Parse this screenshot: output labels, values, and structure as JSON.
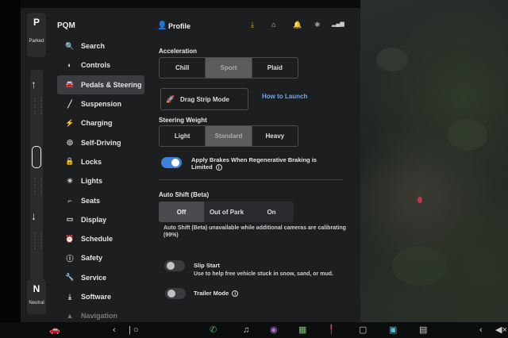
{
  "gear": {
    "top_letter": "P",
    "top_state": "Parked",
    "bottom_letter": "N",
    "bottom_state": "Neutral"
  },
  "menu": {
    "header": "PQM",
    "items": [
      {
        "label": "Search",
        "icon": "search-icon",
        "glyph": "🔍"
      },
      {
        "label": "Controls",
        "icon": "toggle-icon",
        "glyph": "◐"
      },
      {
        "label": "Pedals & Steering",
        "icon": "car-icon",
        "glyph": "🚘"
      },
      {
        "label": "Suspension",
        "icon": "suspension-icon",
        "glyph": "╱"
      },
      {
        "label": "Charging",
        "icon": "bolt-icon",
        "glyph": "⚡"
      },
      {
        "label": "Self-Driving",
        "icon": "steering-wheel-icon",
        "glyph": "◎"
      },
      {
        "label": "Locks",
        "icon": "lock-icon",
        "glyph": "🔒"
      },
      {
        "label": "Lights",
        "icon": "sun-icon",
        "glyph": "☀"
      },
      {
        "label": "Seats",
        "icon": "seat-icon",
        "glyph": "⌐"
      },
      {
        "label": "Display",
        "icon": "display-icon",
        "glyph": "▭"
      },
      {
        "label": "Schedule",
        "icon": "alarm-clock-icon",
        "glyph": "⏰"
      },
      {
        "label": "Safety",
        "icon": "info-circle-icon",
        "glyph": "ⓘ"
      },
      {
        "label": "Service",
        "icon": "wrench-icon",
        "glyph": "🔧"
      },
      {
        "label": "Software",
        "icon": "download-icon",
        "glyph": "⤓"
      },
      {
        "label": "Navigation",
        "icon": "navigation-icon",
        "glyph": "▲"
      }
    ],
    "active_index": 2
  },
  "header": {
    "profile_label": "Profile",
    "profile_icon": "user-icon"
  },
  "settings": {
    "acceleration": {
      "title": "Acceleration",
      "options": [
        "Chill",
        "Sport",
        "Plaid"
      ],
      "selected": "Sport"
    },
    "drag_strip_label": "Drag Strip Mode",
    "how_to_launch": "How to Launch",
    "steering_weight": {
      "title": "Steering Weight",
      "options": [
        "Light",
        "Standard",
        "Heavy"
      ],
      "selected": "Standard"
    },
    "regen_brakes": {
      "label": "Apply Brakes When Regenerative Braking is Limited",
      "enabled": true
    },
    "auto_shift": {
      "title": "Auto Shift (Beta)",
      "options": [
        "Off",
        "Out of Park",
        "On"
      ],
      "selected": "Off",
      "note": "Auto Shift (Beta) unavailable while additional cameras are calibrating (99%)"
    },
    "slip_start": {
      "label": "Slip Start",
      "description": "Use to help free vehicle stuck in snow, sand, or mud.",
      "enabled": false
    },
    "trailer_mode": {
      "label": "Trailer Mode",
      "enabled": false
    }
  },
  "colors": {
    "accent": "#3e7fd8",
    "link": "#6ea8ee",
    "panel": "#1d1e20"
  }
}
